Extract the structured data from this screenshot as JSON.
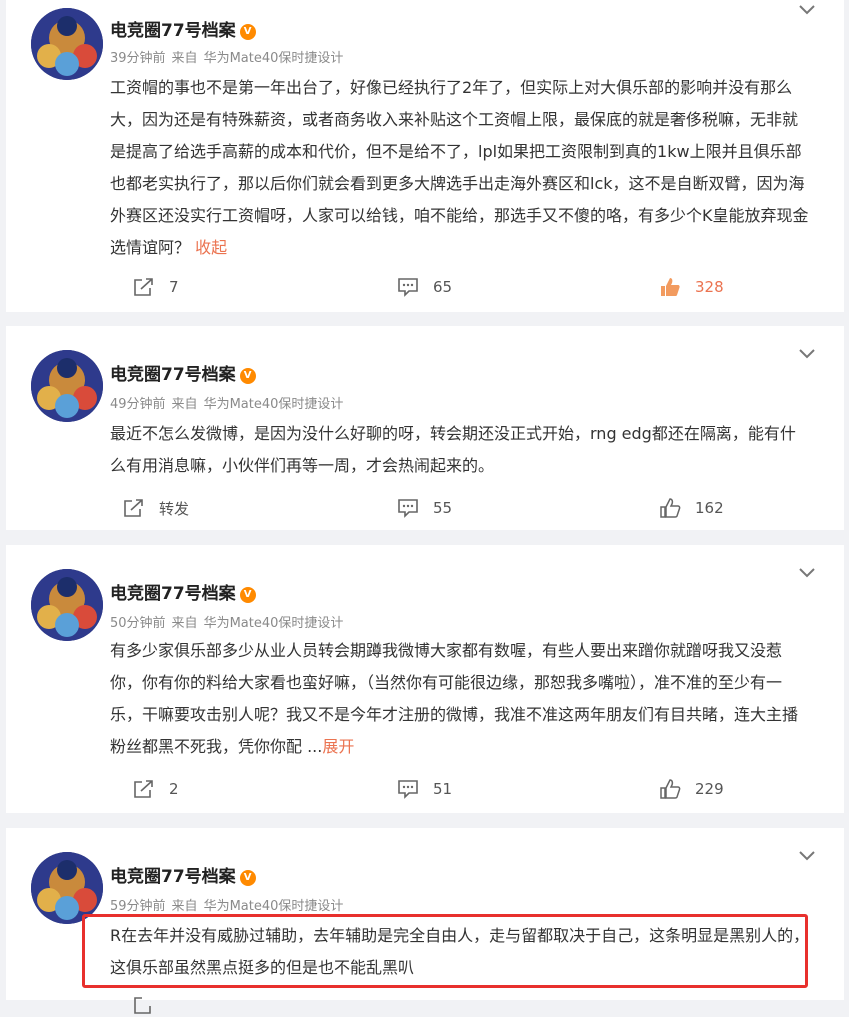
{
  "posts": [
    {
      "author": "电竞圈77号档案",
      "time": "39分钟前",
      "source_prefix": "来自",
      "source": "华为Mate40保时捷设计",
      "text": "工资帽的事也不是第一年出台了，好像已经执行了2年了，但实际上对大俱乐部的影响并没有那么大，因为还是有特殊薪资，或者商务收入来补贴这个工资帽上限，最保底的就是奢侈税嘛，无非就是提高了给选手高薪的成本和代价，但不是给不了，lpl如果把工资限制到真的1kw上限并且俱乐部也都老实执行了，那以后你们就会看到更多大牌选手出走海外赛区和lck，这不是自断双臂，因为海外赛区还没实行工资帽呀，人家可以给钱，咱不能给，那选手又不傻的咯，有多少个K皇能放弃现金选情谊阿？",
      "toggle": "收起",
      "repost": "7",
      "comments": "65",
      "likes": "328",
      "liked": true
    },
    {
      "author": "电竞圈77号档案",
      "time": "49分钟前",
      "source_prefix": "来自",
      "source": "华为Mate40保时捷设计",
      "text": "最近不怎么发微博，是因为没什么好聊的呀，转会期还没正式开始，rng edg都还在隔离，能有什么有用消息嘛，小伙伴们再等一周，才会热闹起来的。",
      "toggle": "",
      "repost": "转发",
      "comments": "55",
      "likes": "162",
      "liked": false
    },
    {
      "author": "电竞圈77号档案",
      "time": "50分钟前",
      "source_prefix": "来自",
      "source": "华为Mate40保时捷设计",
      "text": "有多少家俱乐部多少从业人员转会期蹲我微博大家都有数喔，有些人要出来蹭你就蹭呀我又没惹你，你有你的料给大家看也蛮好嘛，（当然你有可能很边缘，那恕我多嘴啦），准不准的至少有一乐，干嘛要攻击别人呢？我又不是今年才注册的微博，我准不准这两年朋友们有目共睹，连大主播粉丝都黑不死我，凭你你配 ...",
      "toggle": "展开",
      "repost": "2",
      "comments": "51",
      "likes": "229",
      "liked": false
    },
    {
      "author": "电竞圈77号档案",
      "time": "59分钟前",
      "source_prefix": "来自",
      "source": "华为Mate40保时捷设计",
      "text": "R在去年并没有威胁过辅助，去年辅助是完全自由人，走与留都取决于自己，这条明显是黑别人的，这俱乐部虽然黑点挺多的但是也不能乱黑叭"
    }
  ],
  "colors": {
    "accent": "#eb7350",
    "highlight": "#e8302d",
    "background": "#f1f2f5"
  },
  "icons": {
    "repost": "share-icon",
    "comment": "comment-icon",
    "like": "thumbs-up-icon",
    "menu": "chevron-down-icon",
    "badge": "vip-badge-icon"
  }
}
